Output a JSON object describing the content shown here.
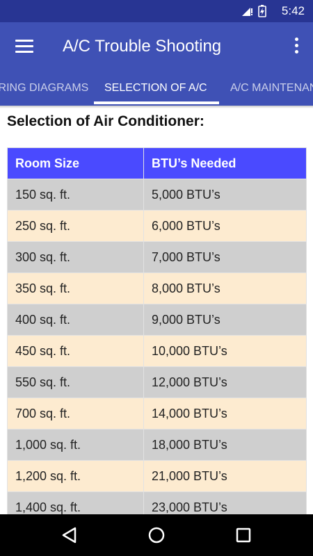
{
  "status_bar": {
    "time": "5:42"
  },
  "app_bar": {
    "title": "A/C Trouble Shooting"
  },
  "tabs": [
    {
      "label": "WIRING DIAGRAMS"
    },
    {
      "label": "SELECTION OF A/C"
    },
    {
      "label": "A/C MAINTENANCE"
    }
  ],
  "section": {
    "title": "Selection of Air Conditioner:"
  },
  "table": {
    "headers": [
      "Room Size",
      "BTU’s Needed"
    ],
    "rows": [
      [
        "150 sq. ft.",
        "5,000 BTU’s"
      ],
      [
        "250 sq. ft.",
        "6,000 BTU’s"
      ],
      [
        "300 sq. ft.",
        "7,000 BTU’s"
      ],
      [
        "350 sq. ft.",
        "8,000 BTU’s"
      ],
      [
        "400 sq. ft.",
        "9,000 BTU’s"
      ],
      [
        "450 sq. ft.",
        "10,000 BTU’s"
      ],
      [
        "550 sq. ft.",
        "12,000 BTU’s"
      ],
      [
        "700 sq. ft.",
        "14,000 BTU’s"
      ],
      [
        "1,000 sq. ft.",
        "18,000 BTU’s"
      ],
      [
        "1,200 sq. ft.",
        "21,000 BTU’s"
      ],
      [
        "1,400 sq. ft.",
        "23,000 BTU’s"
      ]
    ]
  },
  "colors": {
    "status_bar": "#283593",
    "app_bar": "#3f51b5",
    "table_header": "#4a4aff",
    "row_gray": "#cfcfcf",
    "row_beige": "#fdebd0"
  },
  "icons": {
    "status": [
      "wifi-icon",
      "signal-icon",
      "battery-icon"
    ],
    "nav": [
      "back-icon",
      "home-icon",
      "recents-icon"
    ]
  }
}
